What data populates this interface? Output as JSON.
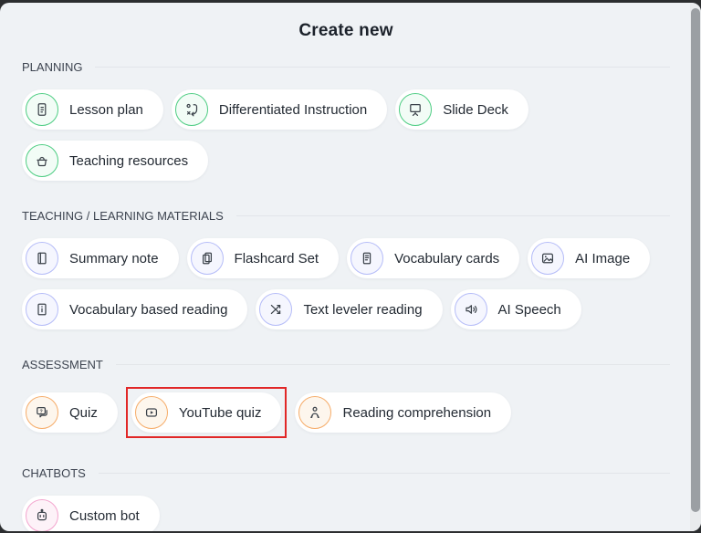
{
  "dialog": {
    "title": "Create new"
  },
  "colors": {
    "background": "#eff2f5",
    "chip_background": "#ffffff",
    "accent_green": "#4ecd83",
    "accent_purple": "#b5bcf8",
    "accent_orange": "#f6ac69",
    "accent_pink": "#f3a5ce",
    "highlight_red": "#e12727"
  },
  "sections": [
    {
      "label": "PLANNING",
      "accent": "green",
      "items": [
        {
          "label": "Lesson plan",
          "icon": "lesson-plan-icon"
        },
        {
          "label": "Differentiated Instruction",
          "icon": "differentiated-instruction-icon"
        },
        {
          "label": "Slide Deck",
          "icon": "slide-deck-icon"
        },
        {
          "label": "Teaching resources",
          "icon": "teaching-resources-icon"
        }
      ]
    },
    {
      "label": "TEACHING / LEARNING MATERIALS",
      "accent": "purple",
      "items": [
        {
          "label": "Summary note",
          "icon": "summary-note-icon"
        },
        {
          "label": "Flashcard Set",
          "icon": "flashcard-set-icon"
        },
        {
          "label": "Vocabulary cards",
          "icon": "vocabulary-cards-icon"
        },
        {
          "label": "AI Image",
          "icon": "ai-image-icon"
        },
        {
          "label": "Vocabulary based reading",
          "icon": "vocabulary-based-reading-icon"
        },
        {
          "label": "Text leveler reading",
          "icon": "text-leveler-reading-icon"
        },
        {
          "label": "AI Speech",
          "icon": "ai-speech-icon"
        }
      ]
    },
    {
      "label": "ASSESSMENT",
      "accent": "orange",
      "items": [
        {
          "label": "Quiz",
          "icon": "quiz-icon"
        },
        {
          "label": "YouTube quiz",
          "icon": "youtube-quiz-icon",
          "highlighted": true
        },
        {
          "label": "Reading comprehension",
          "icon": "reading-comprehension-icon"
        }
      ]
    },
    {
      "label": "CHATBOTS",
      "accent": "pink",
      "items": [
        {
          "label": "Custom bot",
          "icon": "custom-bot-icon"
        }
      ]
    }
  ]
}
